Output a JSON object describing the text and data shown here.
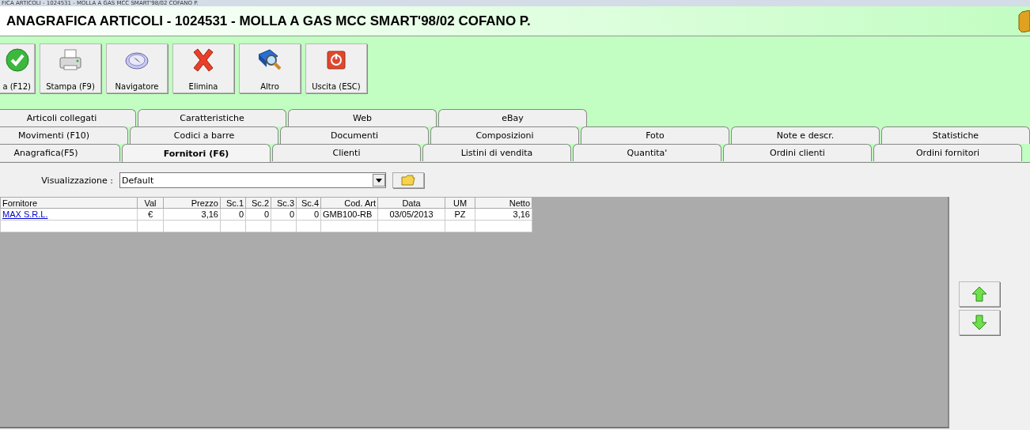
{
  "window": {
    "title": "FICA ARTICOLI - 1024531 - MOLLA A GAS MCC SMART'98/02 COFANO P."
  },
  "header": {
    "title": "ANAGRAFICA ARTICOLI - 1024531 - MOLLA A GAS MCC SMART'98/02 COFANO P."
  },
  "toolbar": {
    "buttons": [
      {
        "label": "a (F12)",
        "kind": "check"
      },
      {
        "label": "Stampa (F9)",
        "kind": "printer"
      },
      {
        "label": "Navigatore",
        "kind": "compass"
      },
      {
        "label": "Elimina",
        "kind": "cross"
      },
      {
        "label": "Altro",
        "kind": "search"
      },
      {
        "label": "Uscita (ESC)",
        "kind": "power"
      }
    ]
  },
  "tab_rows": [
    [
      {
        "label": "Articoli collegati",
        "selected": false
      },
      {
        "label": "Caratteristiche",
        "selected": false
      },
      {
        "label": "Web",
        "selected": false
      },
      {
        "label": "eBay",
        "selected": false
      }
    ],
    [
      {
        "label": "Movimenti (F10)",
        "selected": false
      },
      {
        "label": "Codici a barre",
        "selected": false
      },
      {
        "label": "Documenti",
        "selected": false
      },
      {
        "label": "Composizioni",
        "selected": false
      },
      {
        "label": "Foto",
        "selected": false
      },
      {
        "label": "Note e descr.",
        "selected": false
      },
      {
        "label": "Statistiche",
        "selected": false
      }
    ],
    [
      {
        "label": "Anagrafica(F5)",
        "selected": false
      },
      {
        "label": "Fornitori (F6)",
        "selected": true
      },
      {
        "label": "Clienti",
        "selected": false
      },
      {
        "label": "Listini di vendita",
        "selected": false
      },
      {
        "label": "Quantita'",
        "selected": false
      },
      {
        "label": "Ordini clienti",
        "selected": false
      },
      {
        "label": "Ordini fornitori",
        "selected": false
      }
    ]
  ],
  "view": {
    "label": "Visualizzazione :",
    "value": "Default"
  },
  "table": {
    "columns": [
      {
        "label": "Fornitore",
        "kind": "link"
      },
      {
        "label": "Val",
        "kind": "text"
      },
      {
        "label": "Prezzo",
        "kind": "text"
      },
      {
        "label": "Sc.1",
        "kind": "text"
      },
      {
        "label": "Sc.2",
        "kind": "text"
      },
      {
        "label": "Sc.3",
        "kind": "text"
      },
      {
        "label": "Sc.4",
        "kind": "text"
      },
      {
        "label": "Cod. Art",
        "kind": "text"
      },
      {
        "label": "Data",
        "kind": "text"
      },
      {
        "label": "UM",
        "kind": "text"
      },
      {
        "label": "Netto",
        "kind": "text"
      }
    ],
    "rows": [
      [
        "MAX S.R.L.",
        "€",
        "3,16",
        "0",
        "0",
        "0",
        "0",
        "GMB100-RB",
        "03/05/2013",
        "PZ",
        "3,16"
      ]
    ]
  }
}
